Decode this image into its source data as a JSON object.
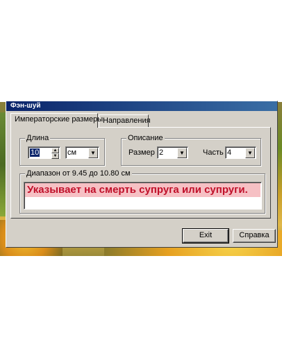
{
  "window": {
    "title": "Фэн-шуй"
  },
  "tabs": [
    {
      "label": "Императорские размеры",
      "active": true
    },
    {
      "label": "Направления",
      "active": false
    }
  ],
  "length_group": {
    "legend": "Длина",
    "value": "10",
    "unit": "см",
    "icons": {
      "spin_up": "spin-up-arrow",
      "spin_down": "spin-down-arrow",
      "dropdown": "dropdown-arrow"
    }
  },
  "description_group": {
    "legend": "Описание",
    "size_label": "Размер",
    "size_value": "2",
    "part_label": "Часть",
    "part_value": "4"
  },
  "range_group": {
    "legend": "Диапазон от 9.45 до 10.80 см",
    "message": "Указывает на смерть супруга или супруги.",
    "message_color": "#c0102a",
    "highlight_color": "#f6c0c4"
  },
  "buttons": {
    "exit": "Exit",
    "help": "Справка"
  }
}
